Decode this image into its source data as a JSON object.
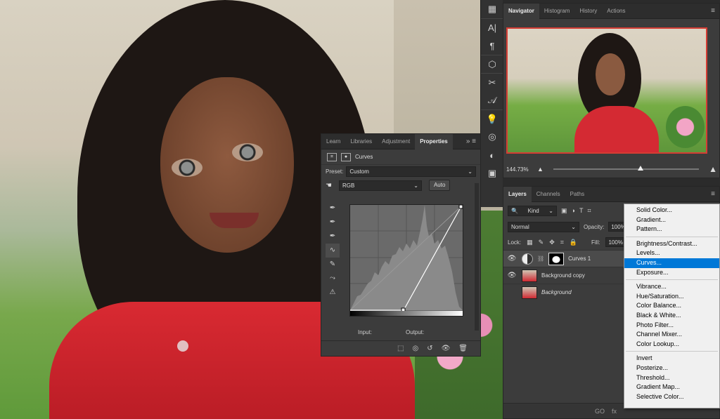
{
  "toolstrip": {
    "icons": [
      "grid-icon",
      "character-icon",
      "paragraph-icon",
      "3d-cube-icon",
      "brush-settings-icon",
      "glyph-icon",
      "light-bulb-icon",
      "cc-libraries-icon",
      "adjustments-icon",
      "styles-icon"
    ]
  },
  "navigator": {
    "tabs": [
      "Navigator",
      "Histogram",
      "History",
      "Actions"
    ],
    "active_tab": "Navigator",
    "zoom": "144.73%",
    "zoom_level": 0.6
  },
  "properties": {
    "tabs": [
      "Learn",
      "Libraries",
      "Adjustment",
      "Properties"
    ],
    "active_tab": "Properties",
    "panel_title": "Curves",
    "preset_label": "Preset:",
    "preset_value": "Custom",
    "channel_value": "RGB",
    "auto_label": "Auto",
    "input_label": "Input:",
    "output_label": "Output:"
  },
  "layers": {
    "tabs": [
      "Layers",
      "Channels",
      "Paths"
    ],
    "active_tab": "Layers",
    "filter_kind": "Kind",
    "blend_mode": "Normal",
    "opacity_label": "Opacity:",
    "opacity_value": "100%",
    "lock_label": "Lock:",
    "fill_label": "Fill:",
    "fill_value": "100%",
    "items": [
      {
        "name": "Curves 1",
        "type": "adjustment",
        "selected": true,
        "visible": true
      },
      {
        "name": "Background copy",
        "type": "image",
        "selected": false,
        "visible": true
      },
      {
        "name": "Background",
        "type": "image",
        "selected": false,
        "visible": false
      }
    ],
    "bottom_icons": [
      "GO",
      "fx"
    ]
  },
  "context_menu": {
    "groups": [
      [
        "Solid Color...",
        "Gradient...",
        "Pattern..."
      ],
      [
        "Brightness/Contrast...",
        "Levels...",
        "Curves...",
        "Exposure..."
      ],
      [
        "Vibrance...",
        "Hue/Saturation...",
        "Color Balance...",
        "Black & White...",
        "Photo Filter...",
        "Channel Mixer...",
        "Color Lookup..."
      ],
      [
        "Invert",
        "Posterize...",
        "Threshold...",
        "Gradient Map...",
        "Selective Color..."
      ]
    ],
    "highlighted": "Curves..."
  },
  "colors": {
    "menu_highlight": "#0078d7",
    "navigator_frame": "#d53d34",
    "panel_bg": "#3c3c3c"
  }
}
